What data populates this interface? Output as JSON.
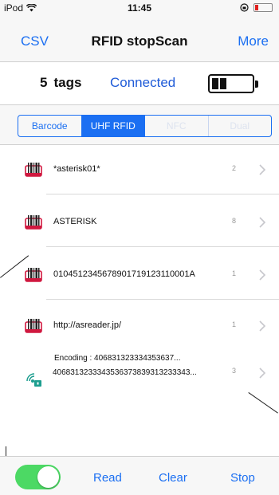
{
  "status_bar": {
    "carrier": "iPod",
    "time": "11:45"
  },
  "nav": {
    "left_label": "CSV",
    "title": "RFID  stopScan",
    "right_label": "More"
  },
  "info": {
    "tag_count": "5",
    "tag_unit": "tags",
    "connection": "Connected"
  },
  "segments": [
    {
      "label": "Barcode",
      "state": "normal"
    },
    {
      "label": "UHF RFID",
      "state": "selected"
    },
    {
      "label": "NFC",
      "state": "disabled"
    },
    {
      "label": "Dual",
      "state": "disabled"
    }
  ],
  "rows": [
    {
      "text": "*asterisk01*",
      "count": "2",
      "icon": "rfid-tag-icon"
    },
    {
      "text": "ASTERISK",
      "count": "8",
      "icon": "rfid-tag-icon"
    },
    {
      "text": "0104512345678901719123110001A",
      "count": "1",
      "icon": "rfid-tag-icon"
    },
    {
      "text": "http://asreader.jp/",
      "count": "1",
      "icon": "rfid-tag-icon"
    }
  ],
  "encoded_row": {
    "encoding": "Encoding : 406831323334353637...",
    "hex": "406831323334353637383931323334​3...",
    "count": "3",
    "icon": "secure-tag-icon"
  },
  "toolbar": {
    "toggle_on": true,
    "read_label": "Read",
    "clear_label": "Clear",
    "stop_label": "Stop"
  },
  "colors": {
    "accent": "#1b6ff2",
    "connected": "#1f5bd8",
    "toggle_on": "#4cd964",
    "tag_icon": "#d0183f",
    "secure_icon": "#1d9e8f"
  }
}
